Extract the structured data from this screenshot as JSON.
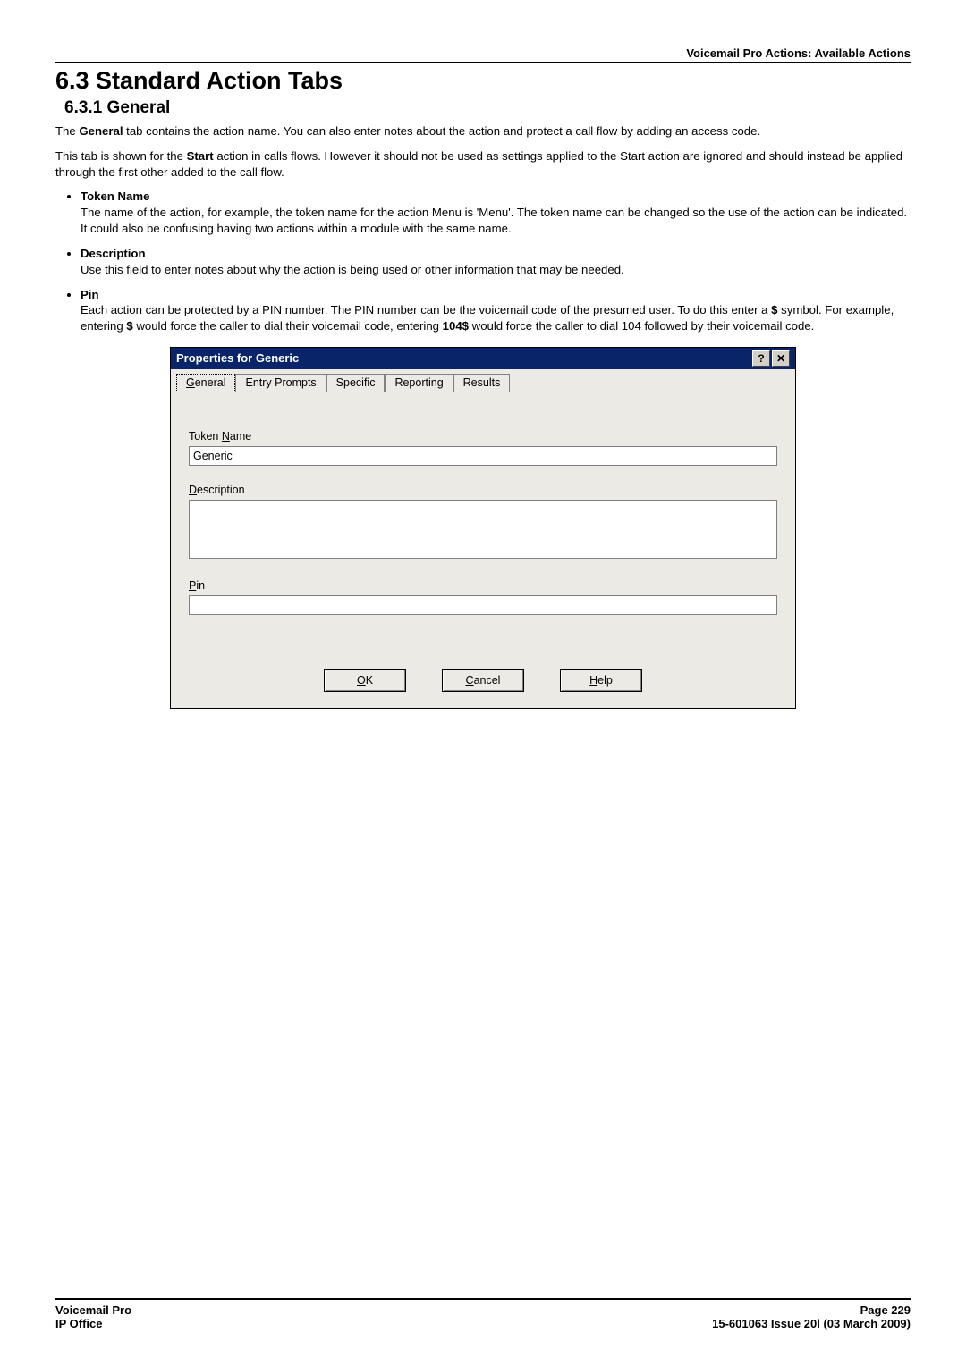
{
  "header": {
    "breadcrumb": "Voicemail Pro Actions: Available Actions"
  },
  "section": {
    "title": "6.3 Standard Action Tabs",
    "subtitle": "6.3.1 General",
    "para1_pre": "The ",
    "para1_bold": "General",
    "para1_post": " tab contains the action name. You can also enter notes about the action and protect a call flow by adding an access code.",
    "para2_pre": "This tab is shown for the ",
    "para2_bold": "Start",
    "para2_post": " action in calls flows. However it should not be used as settings applied to the Start action are ignored and should instead be applied through the first other added to the call flow."
  },
  "bullets": [
    {
      "title": "Token Name",
      "body": "The name of the action, for example, the token name for the action Menu is 'Menu'. The token name can be changed so the use of the action can be indicated. It could also be confusing having two actions within a module with the same name."
    },
    {
      "title": "Description",
      "body": "Use this field to enter notes about why the action is being used or other information that may be needed."
    },
    {
      "title": "Pin",
      "body_pre": "Each action can be protected by a PIN number. The PIN number can be the voicemail code of the presumed user. To do this enter a ",
      "body_b1": "$",
      "body_mid": " symbol. For example, entering ",
      "body_b2": "$",
      "body_mid2": " would force the caller to dial their voicemail code, entering ",
      "body_b3": "104$",
      "body_post": " would force the caller to dial 104 followed by their voicemail code."
    }
  ],
  "dialog": {
    "title": "Properties for Generic",
    "tabs": {
      "general": "eneral",
      "general_u": "G",
      "entry": "Entry Prompts",
      "specific": "Specific",
      "reporting": "Reporting",
      "results": "Results"
    },
    "labels": {
      "token_pre": "Token ",
      "token_u": "N",
      "token_post": "ame",
      "desc_u": "D",
      "desc_post": "escription",
      "pin_u": "P",
      "pin_post": "in"
    },
    "values": {
      "token_name": "Generic",
      "description": "",
      "pin": ""
    },
    "buttons": {
      "ok_u": "O",
      "ok_post": "K",
      "cancel_u": "C",
      "cancel_post": "ancel",
      "help_u": "H",
      "help_post": "elp"
    }
  },
  "footer": {
    "left1": "Voicemail Pro",
    "left2": "IP Office",
    "right1": "Page 229",
    "right2": "15-601063 Issue 20l (03 March 2009)"
  }
}
